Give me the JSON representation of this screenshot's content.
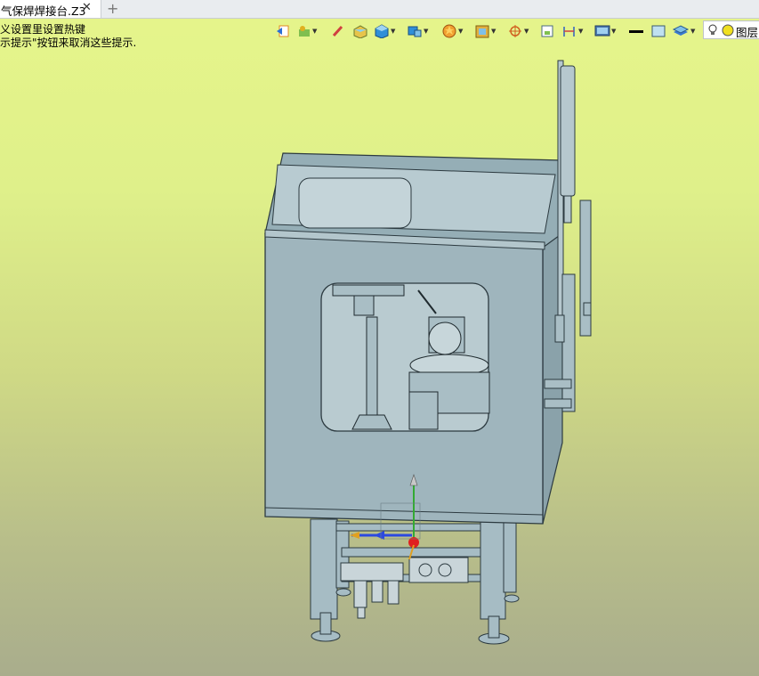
{
  "tab": {
    "title": "气保焊焊接台.Z3",
    "close_symbol": "✕",
    "add_symbol": "+"
  },
  "hint": {
    "line1": "义设置里设置热键",
    "line2": "示提示\"按钮来取消这些提示."
  },
  "toolbar": {
    "icons": [
      "exit-icon",
      "snap-icon",
      "pen-icon",
      "box-icon",
      "shaded-cube-icon",
      "view-cube-icon",
      "render-icon",
      "frame-icon",
      "target-icon",
      "select-icon",
      "dimension-icon",
      "screen-icon",
      "line-color-icon",
      "fill-color-icon",
      "layers-icon",
      "bulb-icon"
    ],
    "layer_label": "图层"
  },
  "colors": {
    "background_top": "#e6f58b",
    "background_bottom": "#a9ad8c",
    "model_fill": "#9fb5bd",
    "model_edge": "#2c3a40"
  }
}
